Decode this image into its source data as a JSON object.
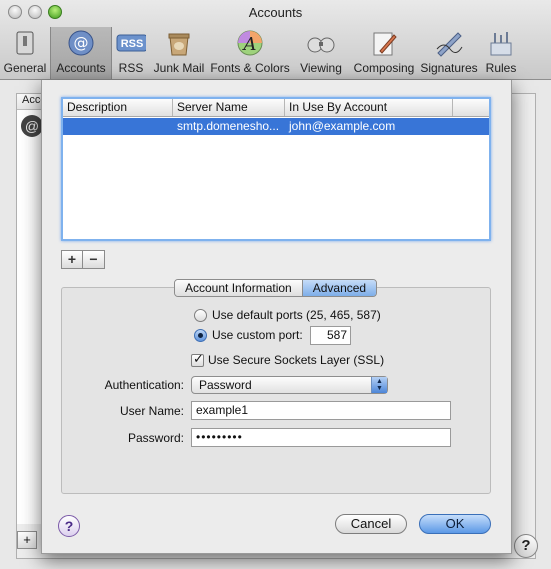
{
  "window": {
    "title": "Accounts"
  },
  "toolbar": {
    "items": [
      {
        "label": "General",
        "icon": "general-icon"
      },
      {
        "label": "Accounts",
        "icon": "at-icon"
      },
      {
        "label": "RSS",
        "icon": "rss-icon"
      },
      {
        "label": "Junk Mail",
        "icon": "junk-mail-icon"
      },
      {
        "label": "Fonts & Colors",
        "icon": "fonts-colors-icon"
      },
      {
        "label": "Viewing",
        "icon": "viewing-icon"
      },
      {
        "label": "Composing",
        "icon": "composing-icon"
      },
      {
        "label": "Signatures",
        "icon": "signatures-icon"
      },
      {
        "label": "Rules",
        "icon": "rules-icon"
      }
    ],
    "rss_badge": "RSS",
    "general_glyph": "▯",
    "accounts_glyph": "@",
    "fonts_glyph": "A"
  },
  "background": {
    "accounts_header": "Acco",
    "account_glyph": "@",
    "add_label": "+",
    "help_label": "?"
  },
  "smtp_table": {
    "columns": [
      "Description",
      "Server Name",
      "In Use By Account"
    ],
    "rows": [
      {
        "description": "",
        "server_name": "smtp.domenesho...",
        "in_use_by": "john@example.com"
      }
    ]
  },
  "list_buttons": {
    "add": "+",
    "remove": "−"
  },
  "tabs": {
    "account_information": "Account Information",
    "advanced": "Advanced",
    "selected": "Advanced"
  },
  "advanced": {
    "default_ports_label": "Use default ports (25, 465, 587)",
    "custom_port_label": "Use custom port:",
    "custom_port_selected": true,
    "port_value": "587",
    "ssl_label": "Use Secure Sockets Layer (SSL)",
    "ssl_checked": true,
    "authentication_label": "Authentication:",
    "authentication_value": "Password",
    "username_label": "User Name:",
    "username_value": "example1",
    "password_label": "Password:",
    "password_value": "•••••••••"
  },
  "footer": {
    "help": "?",
    "cancel": "Cancel",
    "ok": "OK"
  },
  "colors": {
    "selection": "#3875d7",
    "focus_ring": "#7fb2ee",
    "default_button": "#5b98e6"
  }
}
